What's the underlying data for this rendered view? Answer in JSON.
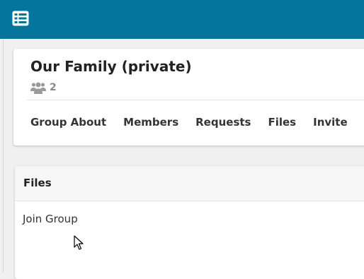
{
  "topbar": {
    "icon": "list-menu-icon",
    "color": "#04759c"
  },
  "group": {
    "title": "Our Family (private)",
    "member_icon": "users-icon",
    "member_count": "2",
    "tabs": [
      {
        "label": "Group About"
      },
      {
        "label": "Members"
      },
      {
        "label": "Requests"
      },
      {
        "label": "Files"
      },
      {
        "label": "Invite"
      }
    ]
  },
  "files": {
    "title": "Files",
    "join_label": "Join Group"
  }
}
